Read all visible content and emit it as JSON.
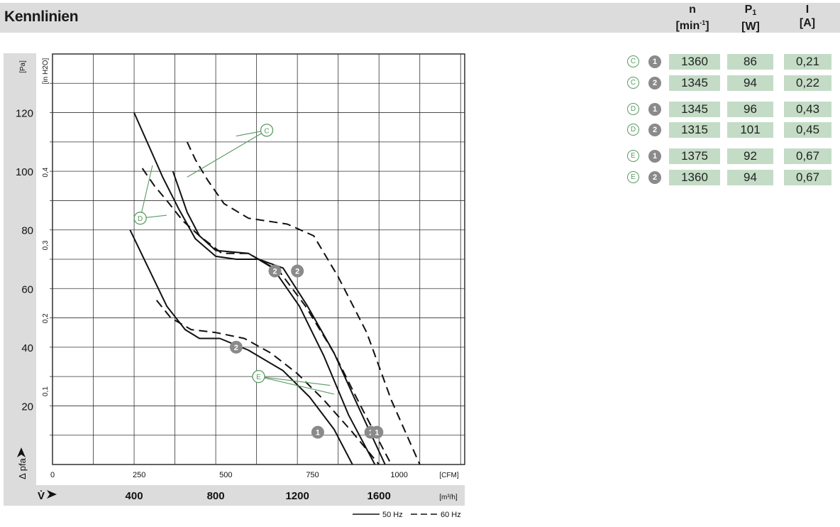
{
  "page": {
    "title": "Kennlinien"
  },
  "table": {
    "headers": [
      {
        "symbol": "n",
        "sub": "",
        "unit_pre": "[min",
        "unit_sup": "-1",
        "unit_post": "]"
      },
      {
        "symbol": "P",
        "sub": "1",
        "unit_pre": "[W]",
        "unit_sup": "",
        "unit_post": ""
      },
      {
        "symbol": "I",
        "sub": "",
        "unit_pre": "[A]",
        "unit_sup": "",
        "unit_post": ""
      }
    ],
    "rows": [
      {
        "curve": "C",
        "point": "1",
        "n": "1360",
        "p1": "86",
        "i": "0,21"
      },
      {
        "curve": "C",
        "point": "2",
        "n": "1345",
        "p1": "94",
        "i": "0,22"
      },
      {
        "curve": "D",
        "point": "1",
        "n": "1345",
        "p1": "96",
        "i": "0,43"
      },
      {
        "curve": "D",
        "point": "2",
        "n": "1315",
        "p1": "101",
        "i": "0,45"
      },
      {
        "curve": "E",
        "point": "1",
        "n": "1375",
        "p1": "92",
        "i": "0,67"
      },
      {
        "curve": "E",
        "point": "2",
        "n": "1360",
        "p1": "94",
        "i": "0,67"
      }
    ]
  },
  "chart_data": {
    "type": "line",
    "title": "",
    "xlabel": "V̇",
    "ylabel": "Δ pfa",
    "x_unit": "[m³/h]",
    "x_secondary_unit": "[CFM]",
    "y_unit": "[Pa]",
    "y_secondary_unit": "[in H2O]",
    "xlim": [
      0,
      2020
    ],
    "ylim": [
      0,
      140
    ],
    "x_ticks": [
      400,
      800,
      1200,
      1600
    ],
    "x_secondary_ticks": [
      {
        "v": 0,
        "label": "0"
      },
      {
        "v": 250,
        "label": "250"
      },
      {
        "v": 500,
        "label": "500"
      },
      {
        "v": 750,
        "label": "750"
      },
      {
        "v": 1000,
        "label": "1000"
      }
    ],
    "y_ticks": [
      20,
      40,
      60,
      80,
      100,
      120
    ],
    "y_secondary_ticks": [
      {
        "v": 0.1,
        "label": "0,1"
      },
      {
        "v": 0.2,
        "label": "0,2"
      },
      {
        "v": 0.3,
        "label": "0,3"
      },
      {
        "v": 0.4,
        "label": "0,4"
      }
    ],
    "grid": true,
    "legend": [
      {
        "label": "50 Hz",
        "style": "solid"
      },
      {
        "label": "60 Hz",
        "style": "dashed"
      }
    ],
    "series": [
      {
        "curve": "C",
        "freq": "50 Hz",
        "style": "solid",
        "points": [
          [
            590,
            100
          ],
          [
            660,
            86
          ],
          [
            720,
            78
          ],
          [
            800,
            73
          ],
          [
            960,
            72
          ],
          [
            1080,
            67
          ],
          [
            1210,
            54
          ],
          [
            1330,
            37
          ],
          [
            1450,
            17
          ],
          [
            1580,
            0
          ]
        ]
      },
      {
        "curve": "C",
        "freq": "60 Hz",
        "style": "dashed",
        "points": [
          [
            660,
            110
          ],
          [
            700,
            104
          ],
          [
            760,
            97
          ],
          [
            840,
            89
          ],
          [
            960,
            84
          ],
          [
            1150,
            82
          ],
          [
            1280,
            78
          ],
          [
            1400,
            64
          ],
          [
            1540,
            45
          ],
          [
            1660,
            22
          ],
          [
            1800,
            0
          ]
        ]
      },
      {
        "curve": "D",
        "freq": "50 Hz",
        "style": "solid",
        "points": [
          [
            400,
            120
          ],
          [
            470,
            109
          ],
          [
            540,
            98
          ],
          [
            620,
            87
          ],
          [
            700,
            77
          ],
          [
            800,
            71
          ],
          [
            900,
            70
          ],
          [
            1010,
            70
          ],
          [
            1130,
            67
          ],
          [
            1250,
            54
          ],
          [
            1380,
            38
          ],
          [
            1490,
            21
          ],
          [
            1630,
            0
          ]
        ]
      },
      {
        "curve": "D",
        "freq": "60 Hz",
        "style": "dashed",
        "points": [
          [
            440,
            101
          ],
          [
            500,
            95
          ],
          [
            560,
            90
          ],
          [
            640,
            83
          ],
          [
            720,
            78
          ],
          [
            830,
            72
          ],
          [
            960,
            72
          ],
          [
            1110,
            66
          ],
          [
            1240,
            54
          ],
          [
            1380,
            38
          ],
          [
            1510,
            20
          ],
          [
            1660,
            0
          ]
        ]
      },
      {
        "curve": "E",
        "freq": "50 Hz",
        "style": "solid",
        "points": [
          [
            380,
            80
          ],
          [
            470,
            67
          ],
          [
            560,
            54
          ],
          [
            650,
            46
          ],
          [
            720,
            43
          ],
          [
            820,
            43
          ],
          [
            960,
            39
          ],
          [
            1130,
            32
          ],
          [
            1260,
            23
          ],
          [
            1380,
            12
          ],
          [
            1470,
            0
          ]
        ]
      },
      {
        "curve": "E",
        "freq": "60 Hz",
        "style": "dashed",
        "points": [
          [
            510,
            56
          ],
          [
            580,
            50
          ],
          [
            680,
            46
          ],
          [
            800,
            45
          ],
          [
            940,
            43
          ],
          [
            1070,
            38
          ],
          [
            1200,
            31
          ],
          [
            1330,
            22
          ],
          [
            1470,
            11
          ],
          [
            1600,
            0
          ]
        ]
      }
    ],
    "operating_points": [
      {
        "curve": "C",
        "point": "2",
        "x": 1200,
        "y": 66
      },
      {
        "curve": "D",
        "point": "2",
        "x": 1090,
        "y": 66
      },
      {
        "curve": "E",
        "point": "2",
        "x": 900,
        "y": 40
      },
      {
        "curve": "E",
        "point": "1",
        "x": 1300,
        "y": 11
      },
      {
        "curve": "D",
        "point": "1",
        "x": 1560,
        "y": 11
      },
      {
        "curve": "C",
        "point": "1",
        "x": 1590,
        "y": 11
      }
    ],
    "annotations": [
      {
        "label": "C",
        "curves": [
          "C"
        ]
      },
      {
        "label": "D",
        "curves": [
          "D"
        ]
      },
      {
        "label": "E",
        "curves": [
          "E"
        ]
      }
    ]
  },
  "colors": {
    "band": "#dcdcdc",
    "cell": "#c4dcc6",
    "marker_green": "#5a9a62",
    "marker_grey": "#8a8a8a",
    "curve": "#111111"
  }
}
